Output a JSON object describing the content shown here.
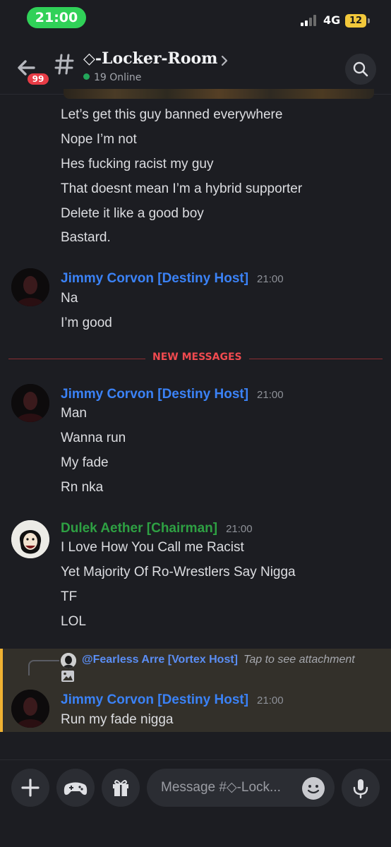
{
  "status_bar": {
    "time": "21:00",
    "network": "4G",
    "battery": "12"
  },
  "header": {
    "unread_badge": "99",
    "channel_name": "◇-Locker-Room",
    "online_text": "19 Online"
  },
  "earlier_messages": [
    "Let’s get this guy banned everywhere",
    "Nope I’m not",
    "Hes fucking racist my guy",
    "That doesnt mean I’m a hybrid supporter",
    "Delete it like a good boy",
    "Bastard."
  ],
  "message_groups": [
    {
      "author": "Jimmy Corvon [Destiny Host]",
      "author_color": "#3b82f6",
      "timestamp": "21:00",
      "lines": [
        "Na",
        "I’m good"
      ]
    },
    {
      "author": "Jimmy Corvon [Destiny Host]",
      "author_color": "#3b82f6",
      "timestamp": "21:00",
      "lines": [
        "Man",
        "Wanna run",
        "My fade",
        "Rn nka"
      ]
    },
    {
      "author": "Dulek Aether [Chairman]",
      "author_color": "#2ea043",
      "timestamp": "21:00",
      "lines": [
        "I Love How You Call me Racist",
        "Yet Majority Of Ro-Wrestlers Say Nigga",
        "TF",
        "LOL"
      ]
    },
    {
      "author": "Jimmy Corvon [Destiny Host]",
      "author_color": "#3b82f6",
      "timestamp": "21:00",
      "lines": [
        "Run my fade nigga"
      ]
    }
  ],
  "new_messages_label": "NEW MESSAGES",
  "reply": {
    "mention": "@Fearless Arre [Vortex Host]",
    "attachment_text": "Tap to see attachment"
  },
  "composer": {
    "placeholder": "Message #◇-Lock..."
  },
  "colors": {
    "accent_online": "#23a55a",
    "mention_highlight": "#f0b232",
    "new_messages": "#f04a4f"
  },
  "icons": [
    "back-arrow-icon",
    "hash-icon",
    "chevron-right-icon",
    "search-icon",
    "plus-icon",
    "gamepad-icon",
    "gift-icon",
    "emoji-icon",
    "microphone-icon",
    "image-icon"
  ]
}
